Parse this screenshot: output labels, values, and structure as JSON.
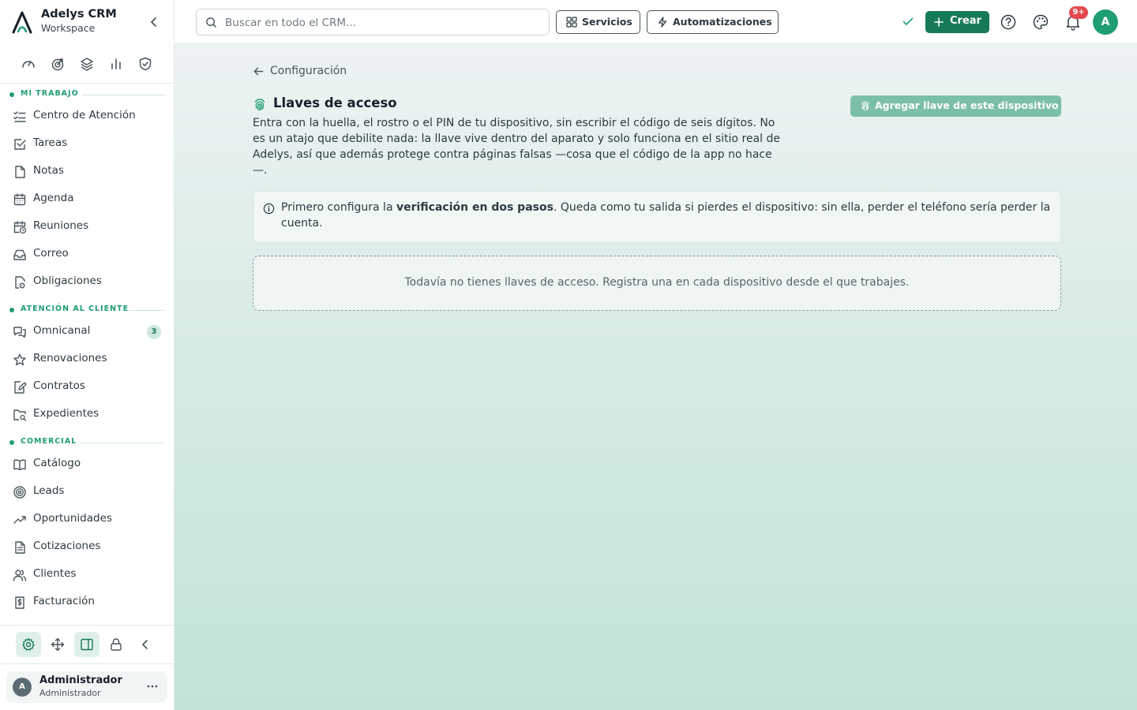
{
  "brand": {
    "name": "Adelys CRM",
    "subtitle": "Workspace"
  },
  "sidebar": {
    "sections": [
      {
        "label": "MI TRABAJO"
      },
      {
        "label": "ATENCIÓN AL CLIENTE"
      },
      {
        "label": "COMERCIAL"
      }
    ],
    "items": [
      {
        "label": "Centro de Atención",
        "icon": "list-check-icon"
      },
      {
        "label": "Tareas",
        "icon": "checkbox-icon"
      },
      {
        "label": "Notas",
        "icon": "document-icon"
      },
      {
        "label": "Agenda",
        "icon": "calendar-icon"
      },
      {
        "label": "Reuniones",
        "icon": "calendar-clock-icon"
      },
      {
        "label": "Correo",
        "icon": "inbox-icon"
      },
      {
        "label": "Obligaciones",
        "icon": "document-gear-icon"
      },
      {
        "label": "Omnicanal",
        "icon": "chat-icon",
        "badge": "3"
      },
      {
        "label": "Renovaciones",
        "icon": "star-icon"
      },
      {
        "label": "Contratos",
        "icon": "document-edit-icon"
      },
      {
        "label": "Expedientes",
        "icon": "folder-search-icon"
      },
      {
        "label": "Catálogo",
        "icon": "book-icon"
      },
      {
        "label": "Leads",
        "icon": "target-icon"
      },
      {
        "label": "Oportunidades",
        "icon": "trending-up-icon"
      },
      {
        "label": "Cotizaciones",
        "icon": "document-lines-icon"
      },
      {
        "label": "Clientes",
        "icon": "users-icon"
      },
      {
        "label": "Facturación",
        "icon": "dollar-document-icon"
      }
    ],
    "quick_icons": [
      "gauge-icon",
      "target-arrow-icon",
      "layers-icon",
      "bar-chart-icon",
      "shield-check-icon"
    ],
    "tools": [
      "gear-icon",
      "move-icon",
      "panel-icon",
      "lock-icon",
      "chevron-left-icon"
    ],
    "user": {
      "initial": "A",
      "name": "Administrador",
      "role": "Administrador"
    }
  },
  "topbar": {
    "search_placeholder": "Buscar en todo el CRM...",
    "services_label": "Servicios",
    "automations_label": "Automatizaciones",
    "create_label": "Crear",
    "notifications_badge": "9+",
    "avatar_initial": "A"
  },
  "page": {
    "back_label": "Configuración",
    "title": "Llaves de acceso",
    "description": "Entra con la huella, el rostro o el PIN de tu dispositivo, sin escribir el código de seis dígitos. No es un atajo que debilite nada: la llave vive dentro del aparato y solo funciona en el sitio real de Adelys, así que además protege contra páginas falsas —cosa que el código de la app no hace —.",
    "add_key_label": "Agregar llave de este dispositivo",
    "info_prefix": "Primero configura la ",
    "info_bold": "verificación en dos pasos",
    "info_suffix": ". Queda como tu salida si pierdes el dispositivo: sin ella, perder el teléfono sería perder la cuenta.",
    "empty_text": "Todavía no tienes llaves de acceso. Registra una en cada dispositivo desde el que trabajes."
  },
  "colors": {
    "accent": "#177a57",
    "accent_light": "#1f9d74",
    "disabled_button": "#7cbfa8",
    "notification": "#e5484d"
  }
}
